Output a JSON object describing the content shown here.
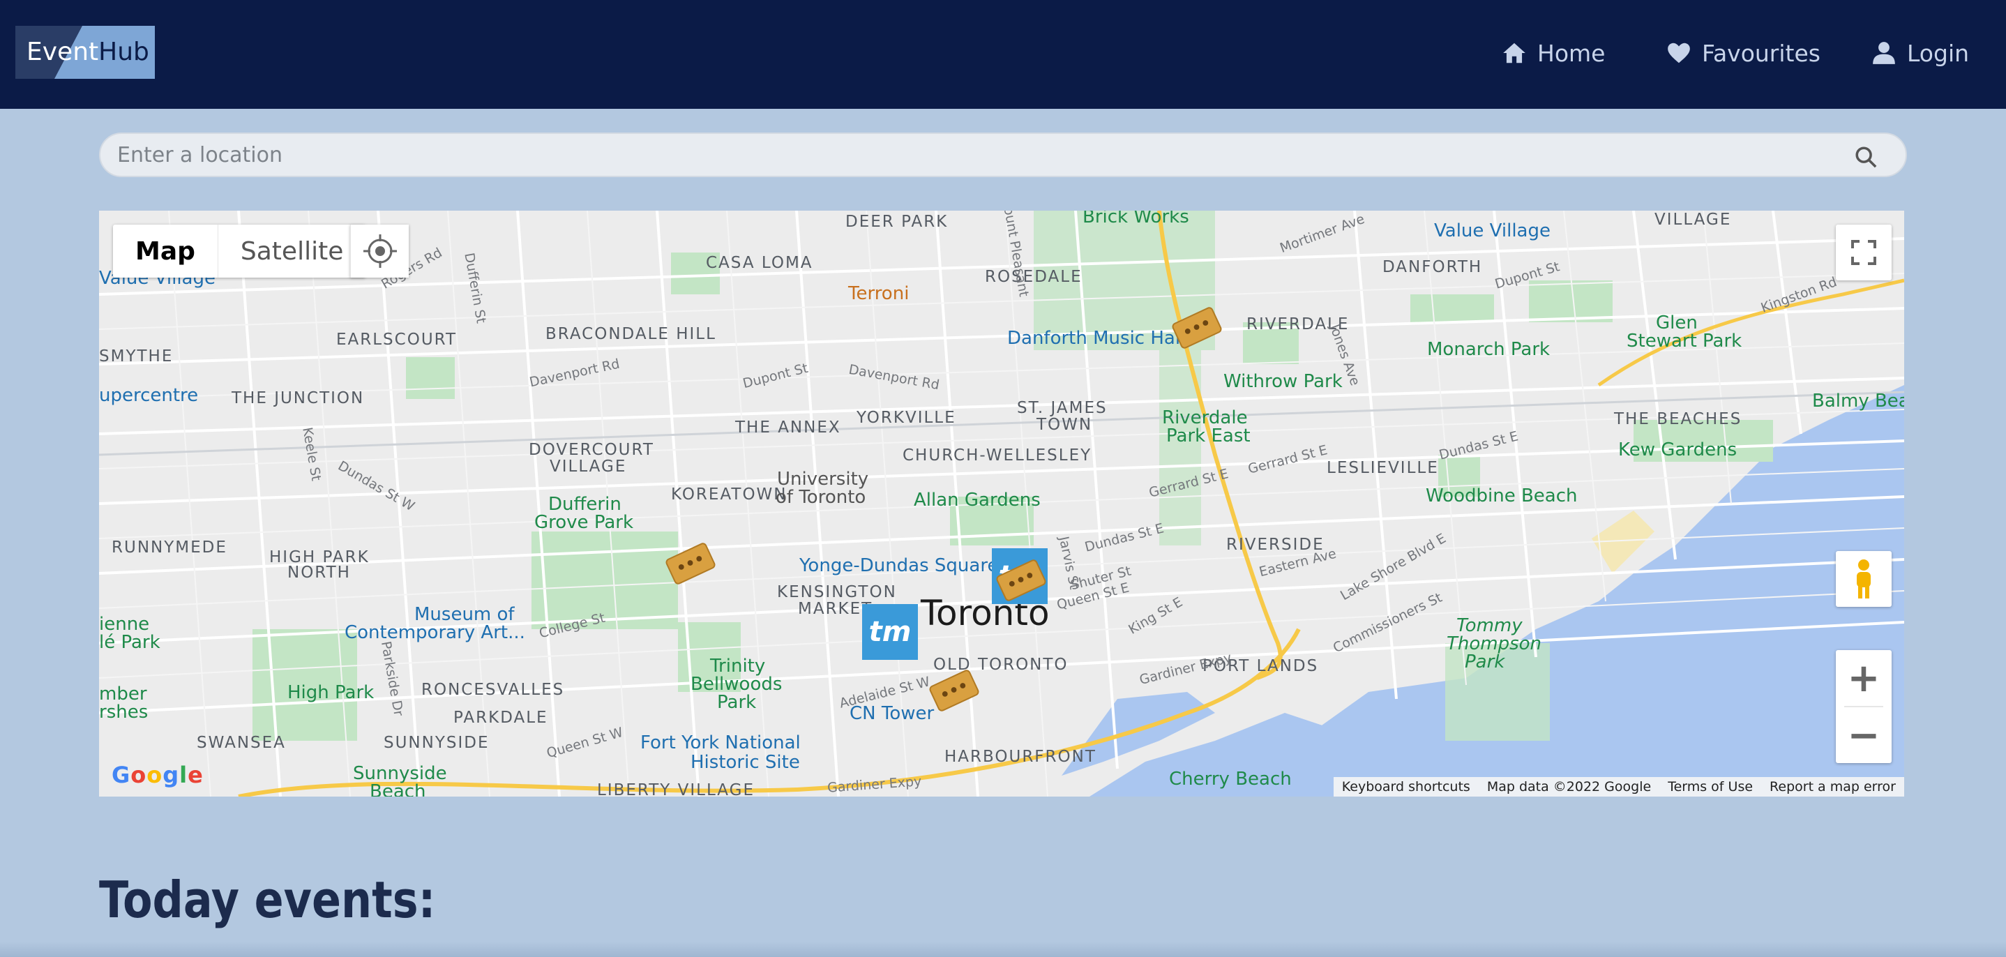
{
  "header": {
    "logo_part1": "Event",
    "logo_part2": "Hub",
    "nav": [
      {
        "label": "Home",
        "icon": "home-icon"
      },
      {
        "label": "Favourites",
        "icon": "heart-icon"
      },
      {
        "label": "Login",
        "icon": "user-icon"
      }
    ]
  },
  "search": {
    "placeholder": "Enter a location",
    "value": ""
  },
  "map": {
    "type_options": [
      "Map",
      "Satellite"
    ],
    "selected_type": "Map",
    "city_label": "Toronto",
    "neighbourhoods": [
      "DEER PARK",
      "CASA LOMA",
      "ROSEDALE",
      "DANFORTH",
      "VILLAGE",
      "EARLSCOURT",
      "BRACONDALE HILL",
      "RIVERDALE",
      "SMYTHE",
      "THE JUNCTION",
      "THE ANNEX",
      "YORKVILLE",
      "ST. JAMES",
      "TOWN",
      "THE BEACHES",
      "DOVERCOURT",
      "VILLAGE",
      "CHURCH-WELLESLEY",
      "LESLIEVILLE",
      "KOREATOWN",
      "RUNNYMEDE",
      "HIGH PARK",
      "NORTH",
      "RIVERSIDE",
      "KENSINGTON",
      "MARKET",
      "OLD TORONTO",
      "RONCESVALLES",
      "PARKDALE",
      "PORT LANDS",
      "SWANSEA",
      "SUNNYSIDE",
      "HARBOURFRONT",
      "LIBERTY VILLAGE"
    ],
    "parks": [
      "Withrow Park",
      "Riverdale",
      "Park East",
      "Monarch Park",
      "Glen",
      "Stewart Park",
      "Balmy Beach",
      "Kew Gardens",
      "Woodbine Beach",
      "Allan Gardens",
      "Dufferin",
      "Grove Park",
      "Trinity",
      "Bellwoods",
      "Park",
      "High Park",
      "Tommy",
      "Thompson",
      "Park",
      "Cherry Beach",
      "Sunnyside",
      "Beach"
    ],
    "pois": [
      "Value Village",
      "Danforth Music Hall",
      "University",
      "of Toronto",
      "Yonge-Dundas Square",
      "Museum of",
      "Contemporary Art...",
      "CN Tower",
      "Fort York National",
      "Historic Site",
      "upercentre",
      "Value Village",
      "Brick Works"
    ],
    "orange_poi": "Terroni",
    "streets": [
      "Davenport Rd",
      "Dupont St",
      "Davenport Rd",
      "Dundas St W",
      "College St",
      "Queen St W",
      "Adelaide St W",
      "Gardiner Expy",
      "Gardiner Expy",
      "Dundas St E",
      "Shuter St",
      "Queen St E",
      "King St E",
      "Gerrard St E",
      "Gerrard St E",
      "Dundas St E",
      "Eastern Ave",
      "Lake Shore Blvd E",
      "Commissioners St",
      "Mortimer Ave",
      "Jones Ave",
      "Kingston Rd",
      "Parkside Dr",
      "Keele St",
      "Dufferin St",
      "Rogers Rd",
      "Dupont St",
      "Jarvis St",
      "Mount Pleasant"
    ],
    "edge_labels": [
      "ienne",
      "lé Park",
      "mber",
      "rshes"
    ],
    "attribution": [
      "Keyboard shortcuts",
      "Map data ©2022 Google",
      "Terms of Use",
      "Report a map error"
    ],
    "google_logo": "Google",
    "marker_badge": "tm",
    "ticket_marker": "•••"
  },
  "section_title": "Today events:",
  "colors": {
    "header_bg": "#0b1b47",
    "page_bg": "#b3c8e0",
    "water": "#aac6f0",
    "park": "#c3e5c5",
    "accent": "#3a9ad9"
  }
}
